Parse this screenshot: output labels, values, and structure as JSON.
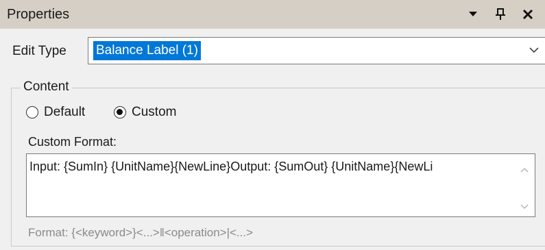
{
  "panel": {
    "title": "Properties",
    "controls": [
      "dropdown-arrow-icon",
      "pin-icon",
      "close-icon"
    ]
  },
  "edit_type": {
    "label": "Edit Type",
    "value": "Balance Label (1)"
  },
  "content": {
    "legend": "Content",
    "options": [
      {
        "label": "Default",
        "checked": false
      },
      {
        "label": "Custom",
        "checked": true
      }
    ]
  },
  "custom_format": {
    "label": "Custom Format:",
    "value": "Input: {SumIn} {UnitName}{NewLine}Output: {SumOut} {UnitName}{NewLi",
    "hint": "Format: {<keyword>}<...>‖<operation>|<...>"
  },
  "colors": {
    "titlebar": "#d6cfc6",
    "selection": "#0078d7",
    "background": "#f0f0f0"
  }
}
